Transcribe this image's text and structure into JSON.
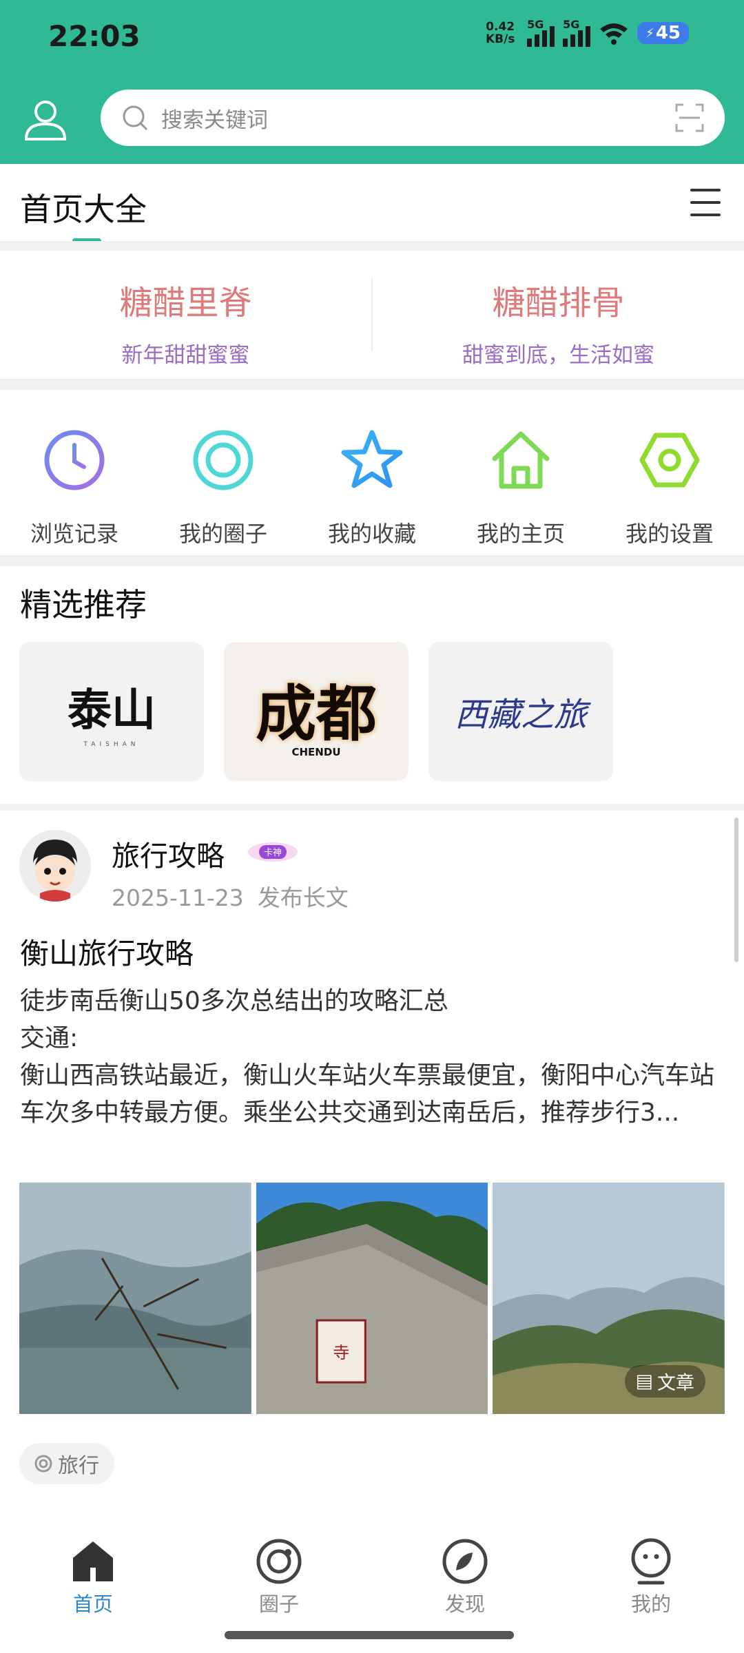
{
  "status_bar": {
    "time": "22:03",
    "net_speed_value": "0.42",
    "net_speed_unit": "KB/s",
    "signal1_label": "5G",
    "signal2_label": "5G",
    "battery": "45"
  },
  "header": {
    "search_placeholder": "搜索关键词",
    "accent_color": "#2fba95"
  },
  "title_row": {
    "title": "首页大全"
  },
  "promo": [
    {
      "title": "糖醋里脊",
      "subtitle": "新年甜甜蜜蜜"
    },
    {
      "title": "糖醋排骨",
      "subtitle": "甜蜜到底，生活如蜜"
    }
  ],
  "shortcuts": [
    {
      "label": "浏览记录",
      "icon": "clock-icon"
    },
    {
      "label": "我的圈子",
      "icon": "circle-icon"
    },
    {
      "label": "我的收藏",
      "icon": "star-icon"
    },
    {
      "label": "我的主页",
      "icon": "home-icon"
    },
    {
      "label": "我的设置",
      "icon": "settings-icon"
    }
  ],
  "featured": {
    "title": "精选推荐",
    "cards": [
      {
        "text": "泰山",
        "sub": "TAISHAN"
      },
      {
        "text": "成都",
        "sub": "CHENDU"
      },
      {
        "text": "西藏之旅",
        "sub": ""
      }
    ]
  },
  "post": {
    "author": "旅行攻略",
    "badge": "卡神",
    "date": "2025-11-23",
    "action": "发布长文",
    "title": "衡山旅行攻略",
    "body_lines": [
      "徒步南岳衡山50多次总结出的攻略汇总",
      "交通:",
      "衡山西高铁站最近，衡山火车站火车票最便宜，衡阳中心汽车站车次多中转最方便。乘坐公共交通到达南岳后，推荐步行3..."
    ],
    "image_tag": "文章",
    "topic": "旅行"
  },
  "bottom_nav": [
    {
      "label": "首页",
      "icon": "home-icon",
      "active": true
    },
    {
      "label": "圈子",
      "icon": "circle-icon",
      "active": false
    },
    {
      "label": "发现",
      "icon": "discover-icon",
      "active": false
    },
    {
      "label": "我的",
      "icon": "profile-icon",
      "active": false
    }
  ]
}
